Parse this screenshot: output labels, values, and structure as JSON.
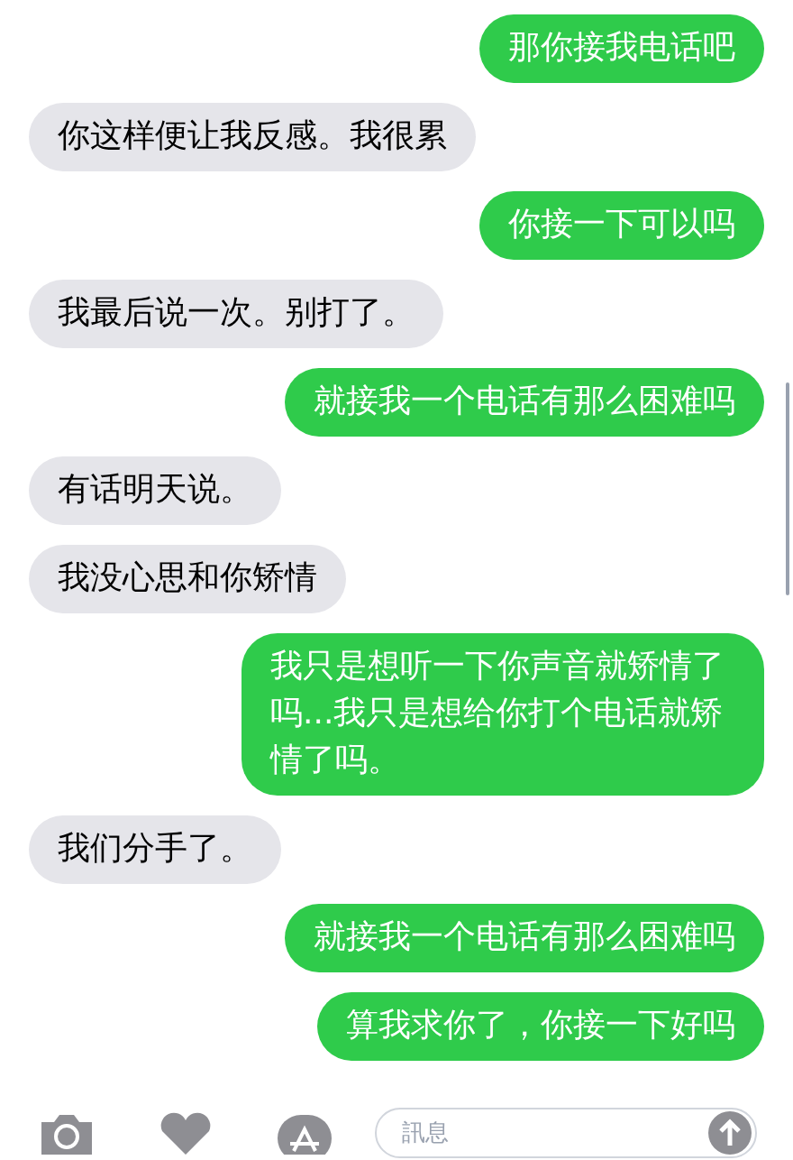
{
  "messages": [
    {
      "kind": "sent",
      "text": "那你接我电话吧"
    },
    {
      "kind": "received",
      "text": "你这样便让我反感。我很累"
    },
    {
      "kind": "sent",
      "text": "你接一下可以吗"
    },
    {
      "kind": "received",
      "text": "我最后说一次。别打了。"
    },
    {
      "kind": "sent",
      "text": "就接我一个电话有那么困难吗"
    },
    {
      "kind": "received",
      "text": "有话明天说。"
    },
    {
      "kind": "received",
      "text": "我没心思和你矫情"
    },
    {
      "kind": "sent",
      "text": "我只是想听一下你声音就矫情了吗...我只是想给你打个电话就矫情了吗。"
    },
    {
      "kind": "received",
      "text": "我们分手了。"
    },
    {
      "kind": "sent",
      "text": "就接我一个电话有那么困难吗"
    },
    {
      "kind": "sent",
      "text": "算我求你了，你接一下好吗"
    }
  ],
  "composer": {
    "placeholder": "訊息"
  }
}
